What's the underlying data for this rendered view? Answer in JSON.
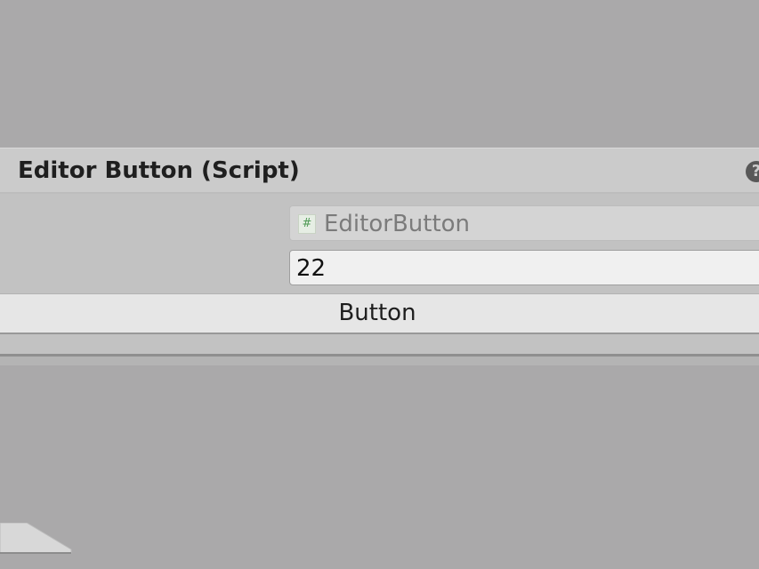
{
  "component": {
    "title": "Editor Button (Script)",
    "help_glyph": "?",
    "help_icon": "help-icon",
    "script_icon": "csharp-script-icon",
    "script_icon_glyph": "#",
    "script_value": "EditorButton",
    "int_value": "22",
    "button_label": "Button"
  },
  "colors": {
    "background": "#aaa9aa",
    "header": "#cbcbcb",
    "body": "#c2c2c2",
    "button": "#e6e6e6"
  }
}
